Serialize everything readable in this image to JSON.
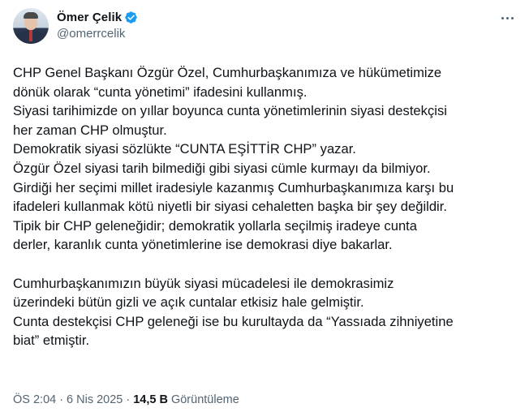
{
  "author": {
    "display_name": "Ömer Çelik",
    "handle": "@omerrcelik",
    "verified_icon": "verified-badge-icon",
    "verified_color": "#1d9bf0"
  },
  "more_icon": "more-options-icon",
  "tweet": {
    "lines": [
      "CHP Genel Başkanı Özgür Özel, Cumhurbaşkanımıza ve hükümetimize",
      "dönük olarak “cunta yönetimi” ifadesini kullanmış.",
      "Siyasi tarihimizde on yıllar boyunca cunta yönetimlerinin siyasi destekçisi",
      "her zaman CHP olmuştur.",
      "Demokratik siyasi sözlükte “CUNTA EŞİTTİR CHP” yazar.",
      "Özgür Özel siyasi tarih bilmediği gibi siyasi cümle kurmayı da bilmiyor.",
      "Girdiği her seçimi millet iradesiyle kazanmış Cumhurbaşkanımıza karşı bu",
      "ifadeleri kullanmak kötü niyetli bir siyasi cehaletten başka bir şey değildir.",
      "Tipik bir CHP geleneğidir; demokratik yollarla seçilmiş iradeye cunta",
      "derler, karanlık cunta yönetimlerine ise demokrasi diye bakarlar.",
      "",
      "Cumhurbaşkanımızın büyük siyasi mücadelesi ile demokrasimiz",
      "üzerindeki bütün gizli ve açık cuntalar etkisiz hale gelmiştir.",
      "Cunta destekçisi CHP geleneği ise bu kurultayda da “Yassıada zihniyetine",
      "biat” etmiştir."
    ]
  },
  "meta": {
    "time": "ÖS 2:04",
    "separator": "·",
    "date": "6 Nis 2025",
    "views_count": "14,5 B",
    "views_label": "Görüntüleme"
  }
}
